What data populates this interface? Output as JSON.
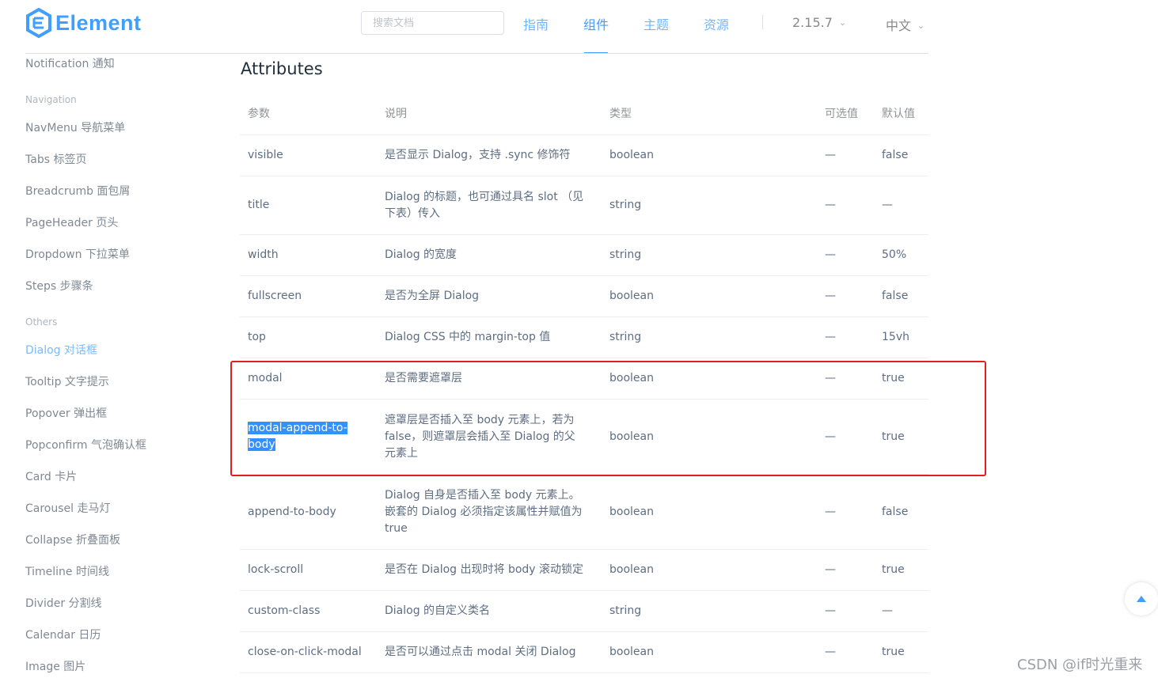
{
  "header": {
    "logo_text": "Element",
    "search_placeholder": "搜索文档",
    "nav": [
      "指南",
      "组件",
      "主题",
      "资源"
    ],
    "active_nav": "组件",
    "version": "2.15.7",
    "language": "中文",
    "brand_color": "#409eff"
  },
  "sidebar": {
    "top_item": "Notification 通知",
    "group_navigation": "Navigation",
    "navigation_items": [
      "NavMenu 导航菜单",
      "Tabs 标签页",
      "Breadcrumb 面包屑",
      "PageHeader 页头",
      "Dropdown 下拉菜单",
      "Steps 步骤条"
    ],
    "group_others": "Others",
    "others_items": [
      "Dialog 对话框",
      "Tooltip 文字提示",
      "Popover 弹出框",
      "Popconfirm 气泡确认框",
      "Card 卡片",
      "Carousel 走马灯",
      "Collapse 折叠面板",
      "Timeline 时间线",
      "Divider 分割线",
      "Calendar 日历",
      "Image 图片"
    ],
    "active_item": "Dialog 对话框"
  },
  "content": {
    "title": "Attributes",
    "columns": [
      "参数",
      "说明",
      "类型",
      "可选值",
      "默认值"
    ],
    "rows": [
      [
        "visible",
        "是否显示 Dialog，支持 .sync 修饰符",
        "boolean",
        "—",
        "false"
      ],
      [
        "title",
        "Dialog 的标题，也可通过具名 slot （见下表）传入",
        "string",
        "—",
        "—"
      ],
      [
        "width",
        "Dialog 的宽度",
        "string",
        "—",
        "50%"
      ],
      [
        "fullscreen",
        "是否为全屏 Dialog",
        "boolean",
        "—",
        "false"
      ],
      [
        "top",
        "Dialog CSS 中的 margin-top 值",
        "string",
        "—",
        "15vh"
      ],
      [
        "modal",
        "是否需要遮罩层",
        "boolean",
        "—",
        "true"
      ],
      [
        "modal-append-to-body",
        "遮罩层是否插入至 body 元素上，若为 false，则遮罩层会插入至 Dialog 的父元素上",
        "boolean",
        "—",
        "true"
      ],
      [
        "append-to-body",
        "Dialog 自身是否插入至 body 元素上。嵌套的 Dialog 必须指定该属性并赋值为 true",
        "boolean",
        "—",
        "false"
      ],
      [
        "lock-scroll",
        "是否在 Dialog 出现时将 body 滚动锁定",
        "boolean",
        "—",
        "true"
      ],
      [
        "custom-class",
        "Dialog 的自定义类名",
        "string",
        "—",
        "—"
      ],
      [
        "close-on-click-modal",
        "是否可以通过点击 modal 关闭 Dialog",
        "boolean",
        "—",
        "true"
      ]
    ],
    "selected_text": "modal-append-to-body",
    "highlight_color": "#e02020"
  },
  "watermark": "CSDN @if时光重来"
}
